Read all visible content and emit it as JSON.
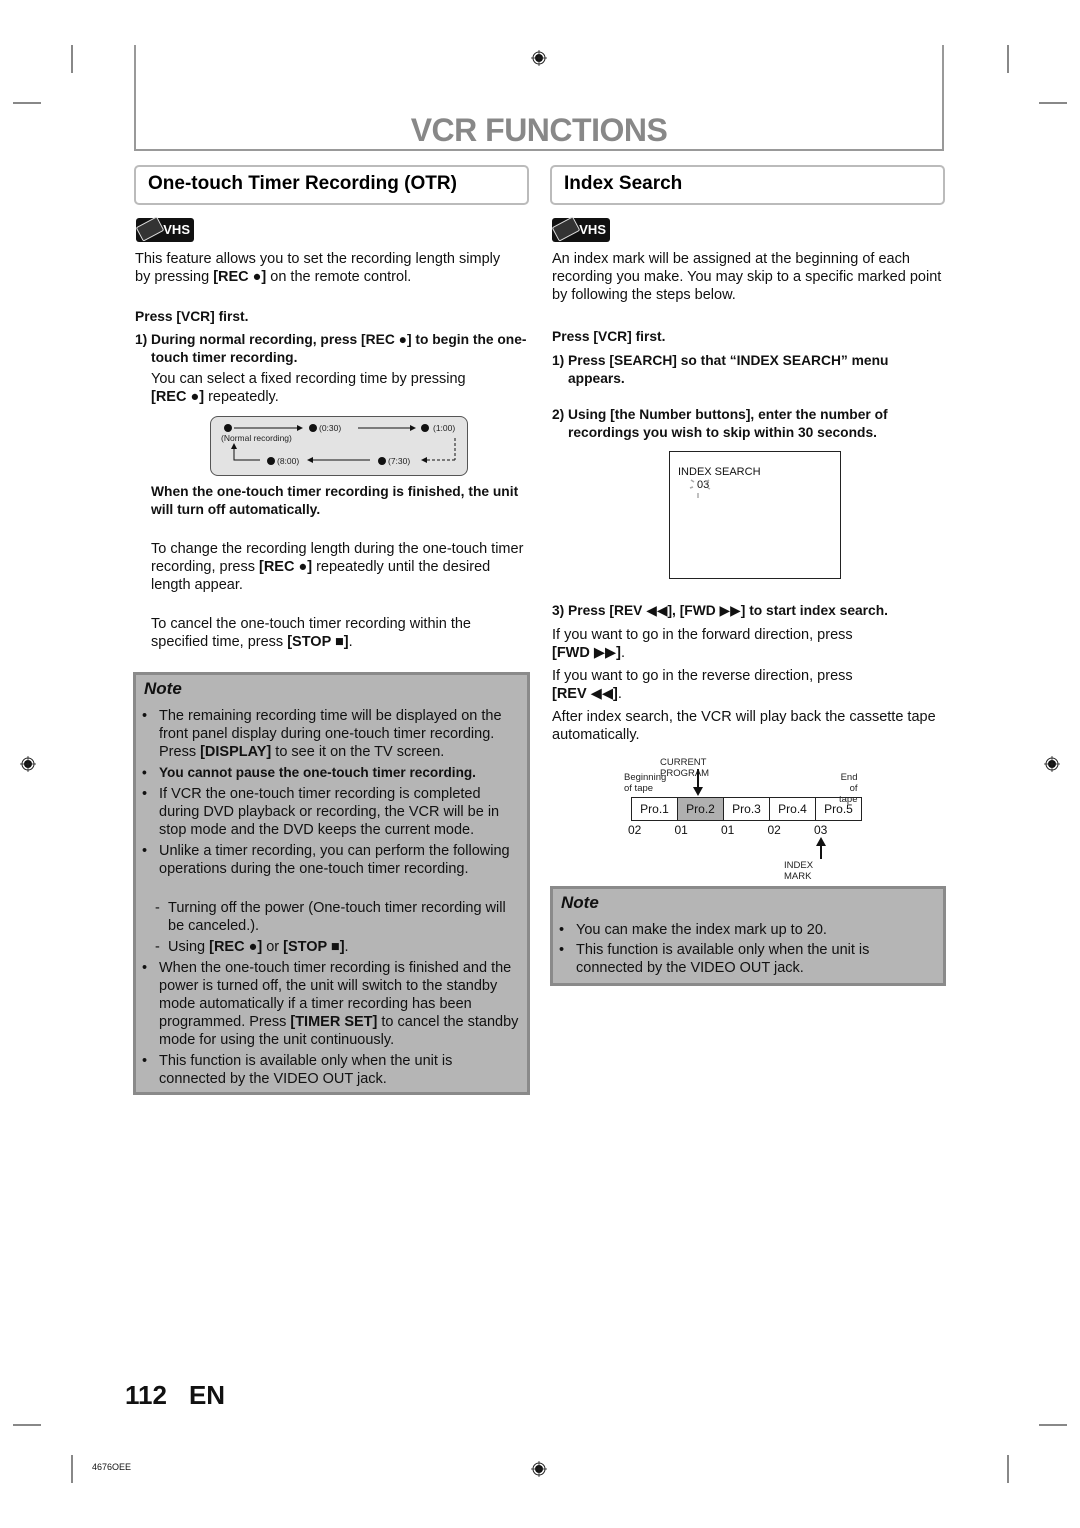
{
  "header": {
    "title": "VCR FUNCTIONS"
  },
  "left": {
    "section_title": "One-touch Timer Recording (OTR)",
    "badge": "VHS",
    "intro": [
      "This feature allows you to set the recording length simply",
      "by pressing ",
      "[REC ●]",
      " on the remote control."
    ],
    "press_first": "Press [VCR] first.",
    "step1": {
      "num": "1)",
      "text": "During normal recording, press [REC ●] to begin the one-touch timer recording."
    },
    "step1_desc_a": "You can select a fixed recording time by pressing",
    "step1_desc_b": "[REC ●]",
    "step1_desc_c": " repeatedly.",
    "diagram": {
      "normal": "(Normal recording)",
      "times": [
        "(0:30)",
        "(1:00)",
        "(7:30)",
        "(8:00)"
      ]
    },
    "finish_bold": "When the one-touch timer recording is finished, the unit will turn off automatically.",
    "change": {
      "a": "To change the recording length during the one-touch timer recording, press ",
      "b": "[REC ●]",
      "c": " repeatedly until the desired length appear."
    },
    "cancel": {
      "a": "To cancel the one-touch timer recording within the specified time, press ",
      "b": "[STOP ■]",
      "c": "."
    },
    "note": {
      "title": "Note",
      "items": [
        {
          "a": "The remaining recording time will be displayed on the front panel display during one-touch timer recording. Press ",
          "b": "[DISPLAY]",
          "c": " to see it on the TV screen."
        },
        {
          "b": "You cannot pause the one-touch timer recording."
        },
        {
          "a": "If VCR the one-touch timer recording is completed during DVD playback or recording, the VCR will be in stop mode and the DVD keeps the current mode."
        },
        {
          "a": "Unlike a timer recording, you can perform the following operations during the one-touch timer recording."
        },
        {
          "a": "Turning off the power (One-touch timer recording will be canceled.)."
        },
        {
          "a": "Using ",
          "b": "[REC ●]",
          "c": " or ",
          "d": "[STOP ■]",
          "e": "."
        },
        {
          "a": "When the one-touch timer recording is finished and the power is turned off, the unit will switch to the standby mode automatically if a timer recording has been programmed. Press ",
          "b": "[TIMER SET]",
          "c": " to cancel the standby mode for using the unit continuously."
        },
        {
          "a": "This function is available only when the unit is connected by the VIDEO OUT jack."
        }
      ],
      "bullet": "•",
      "dash": "-"
    }
  },
  "right": {
    "section_title": "Index Search",
    "badge": "VHS",
    "intro": "An index mark will be assigned at the beginning of each recording you make. You may skip to a specific marked point by following the steps below.",
    "press_first": "Press [VCR] first.",
    "step1": {
      "num": "1)",
      "text": "Press [SEARCH] so that “INDEX SEARCH” menu appears."
    },
    "step2": {
      "num": "2)",
      "text": "Using [the Number buttons], enter the number of recordings you wish to skip within 30 seconds."
    },
    "screen": {
      "title": "INDEX SEARCH",
      "value": "03"
    },
    "step3": {
      "num": "3)",
      "text": "Press [REV ◀◀], [FWD ▶▶] to start index search."
    },
    "fwd": {
      "a": "If you want to go in the forward direction, press",
      "b": "[FWD ▶▶]",
      "c": "."
    },
    "rev": {
      "a": "If you want to go in the reverse direction, press",
      "b": "[REV ◀◀]",
      "c": "."
    },
    "after": "After index search, the VCR will play back the cassette tape automatically.",
    "tape": {
      "current_label": "CURRENT PROGRAM",
      "begin_label": [
        "Beginning",
        "of tape"
      ],
      "end_label": [
        "End",
        "of tape"
      ],
      "programs": [
        "Pro.1",
        "Pro.2",
        "Pro.3",
        "Pro.4",
        "Pro.5"
      ],
      "current_index": 1,
      "marks": [
        "02",
        "01",
        "01",
        "02",
        "03"
      ],
      "index_mark_label": "INDEX MARK",
      "highlight_color": "#b0b0b0"
    },
    "note": {
      "title": "Note",
      "items": [
        "You can make the index mark up to 20.",
        "This function is available only when the unit is connected by the VIDEO OUT jack."
      ],
      "bullet": "•"
    }
  },
  "footer": {
    "page": "112",
    "lang": "EN",
    "code": "4676OEE"
  }
}
